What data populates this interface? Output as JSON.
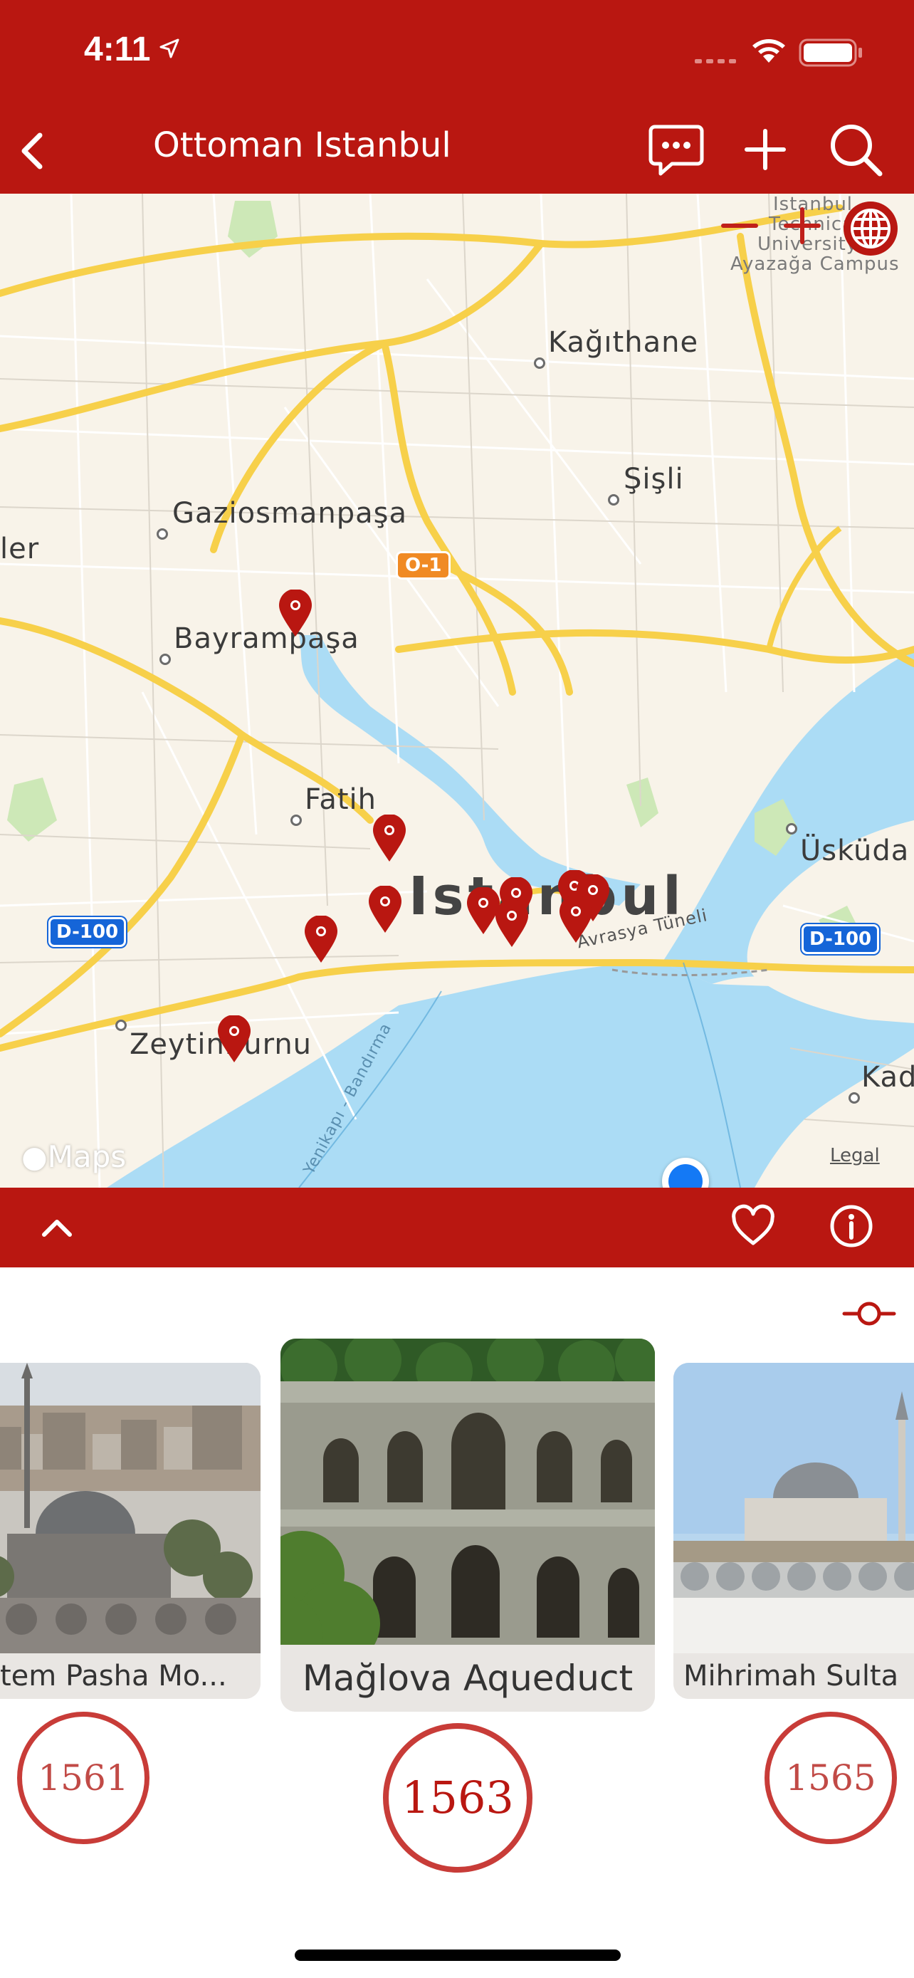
{
  "status_bar": {
    "time": "4:11",
    "location_icon": "location-arrow-icon",
    "signal_icon": "cellular-signal-icon",
    "wifi_icon": "wifi-icon",
    "battery_icon": "battery-icon"
  },
  "nav": {
    "title": "Ottoman Istanbul",
    "back_icon": "chevron-left-icon",
    "chat_icon": "chat-bubble-icon",
    "add_icon": "plus-icon",
    "search_icon": "search-icon"
  },
  "map": {
    "labels": {
      "istanbul": "Istanbul",
      "kagithane": "Kağıthane",
      "sisli": "Şişli",
      "gaziosmanpasa": "Gaziosmanpaşa",
      "bayrampasa": "Bayrampaşa",
      "fatih": "Fatih",
      "zeytinburnu": "Zeytinburnu",
      "uskudar": "Üsküda",
      "kad": "Kad",
      "ler": "ler",
      "itu_line1": "Istanbul",
      "itu_line2": "Technical",
      "itu_line3": "University",
      "itu_line4": "Ayazağa Campus",
      "avrasya": "Avrasya Tüneli",
      "yenikapi": "Yenikapı - Bandırma"
    },
    "road_badges": {
      "d100_left": "D-100",
      "d100_right": "D-100",
      "o1": "O-1"
    },
    "attribution": "Maps",
    "legal": "Legal",
    "zoom_out_icon": "minus-icon",
    "zoom_in_icon": "plus-icon",
    "globe_icon": "globe-icon",
    "pin_icon": "map-pin-icon",
    "colors": {
      "land": "#f8f3e9",
      "water": "#abdcf5",
      "major_road": "#f7d04a",
      "pin": "#b91711",
      "user_location": "#1479f5"
    }
  },
  "toolbar": {
    "expand_icon": "chevron-up-icon",
    "favorite_icon": "heart-icon",
    "info_icon": "info-icon"
  },
  "filter_icon": "timeline-filter-icon",
  "cards": [
    {
      "title": "Rüstem Pasha Mo...",
      "display": "tem Pasha Mo...",
      "year": "1561"
    },
    {
      "title": "Mağlova Aqueduct",
      "display": "Mağlova Aqueduct",
      "year": "1563"
    },
    {
      "title": "Mihrimah Sultan",
      "display": "Mihrimah Sulta",
      "year": "1565"
    }
  ],
  "theme": {
    "brand_red": "#b91711",
    "year_ring": "#c83c38"
  }
}
